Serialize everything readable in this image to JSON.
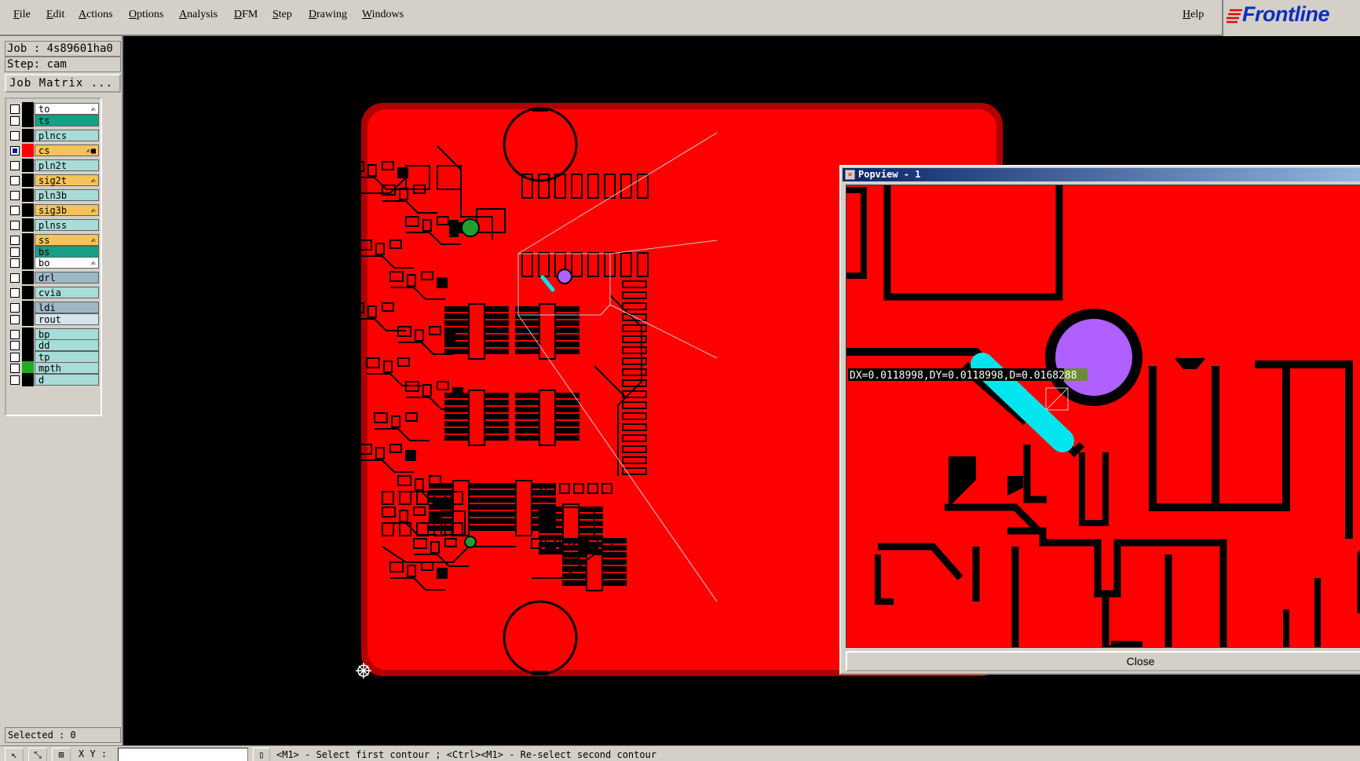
{
  "menu": {
    "items": [
      "File",
      "Edit",
      "Actions",
      "Options",
      "Analysis",
      "DFM",
      "Step",
      "Drawing",
      "Windows"
    ],
    "help": "Help"
  },
  "logo": {
    "text": "Frontline"
  },
  "left": {
    "job": "Job : 4s89601ha0",
    "step": "Step: cam",
    "job_matrix": "Job Matrix ...",
    "selected": "Selected : 0"
  },
  "layers": [
    {
      "name": "to",
      "color": "#ffffff",
      "flag": "✍",
      "mark": "#000000",
      "checked": false
    },
    {
      "name": "ts",
      "color": "#16a085",
      "flag": "",
      "mark": "#000000",
      "checked": false
    },
    {
      "name": "plncs",
      "color": "#a8dcd8",
      "flag": "",
      "mark": "#000000",
      "checked": false
    },
    {
      "name": "cs",
      "color": "#f6c35b",
      "flag": "✍■",
      "mark": "#ff0000",
      "checked": true
    },
    {
      "name": "pln2t",
      "color": "#a8dcd8",
      "flag": "",
      "mark": "#000000",
      "checked": false
    },
    {
      "name": "sig2t",
      "color": "#f6c35b",
      "flag": "✍",
      "mark": "#000000",
      "checked": false
    },
    {
      "name": "pln3b",
      "color": "#a8dcd8",
      "flag": "",
      "mark": "#000000",
      "checked": false
    },
    {
      "name": "sig3b",
      "color": "#f6c35b",
      "flag": "✍",
      "mark": "#000000",
      "checked": false
    },
    {
      "name": "plnss",
      "color": "#a8dcd8",
      "flag": "",
      "mark": "#000000",
      "checked": false
    },
    {
      "name": "ss",
      "color": "#f6c35b",
      "flag": "✍",
      "mark": "#000000",
      "checked": false
    },
    {
      "name": "bs",
      "color": "#16a085",
      "flag": "",
      "mark": "#000000",
      "checked": false
    },
    {
      "name": "bo",
      "color": "#ffffff",
      "flag": "✍",
      "mark": "#000000",
      "checked": false
    },
    {
      "name": "drl",
      "color": "#9cb8c4",
      "flag": "",
      "mark": "#000000",
      "checked": false
    },
    {
      "name": "cvia",
      "color": "#a8dcd8",
      "flag": "",
      "mark": "#000000",
      "checked": false
    },
    {
      "name": "ldi",
      "color": "#9cb8c4",
      "flag": "",
      "mark": "#000000",
      "checked": false
    },
    {
      "name": "rout",
      "color": "#d4e4ec",
      "flag": "",
      "mark": "#000000",
      "checked": false
    },
    {
      "name": "bp",
      "color": "#a8dcd8",
      "flag": "",
      "mark": "#000000",
      "checked": false
    },
    {
      "name": "dd",
      "color": "#a8dcd8",
      "flag": "",
      "mark": "#000000",
      "checked": false
    },
    {
      "name": "tp",
      "color": "#a8dcd8",
      "flag": "",
      "mark": "#000000",
      "checked": false
    },
    {
      "name": "mpth",
      "color": "#a8dcd8",
      "flag": "",
      "mark": "#22aa22",
      "checked": false
    },
    {
      "name": "d",
      "color": "#a8dcd8",
      "flag": "",
      "mark": "#000000",
      "checked": false
    }
  ],
  "popview": {
    "title": "Popview - 1",
    "measure": "DX=0.0118998,DY=0.0118998,D=0.0168288",
    "close": "Close"
  },
  "status": {
    "xy_label": "X Y :",
    "prompt": "<M1> - Select first contour ; <Ctrl><M1> - Re-select second contour"
  },
  "colors": {
    "copper": "#ff0000",
    "background": "#000000",
    "trace_highlight": "#00e5ee",
    "pad_highlight": "#b060ff",
    "drill": "#1fa02f"
  }
}
